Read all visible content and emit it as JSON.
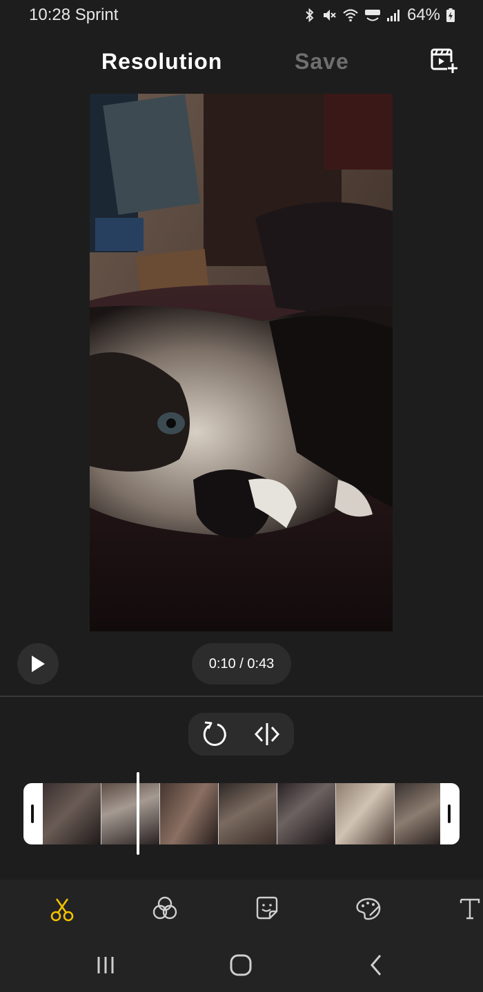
{
  "status_bar": {
    "time_carrier": "10:28 Sprint",
    "battery": "64%"
  },
  "header": {
    "title": "Resolution",
    "save_label": "Save"
  },
  "player": {
    "time": "0:10 / 0:43"
  },
  "colors": {
    "background": "#1d1d1d",
    "accent_active_tool": "#f2c200",
    "save_disabled": "#6f6f6f"
  },
  "bottom_tools": [
    "scissors-icon",
    "filter-icon",
    "sticker-icon",
    "palette-icon",
    "text-icon"
  ],
  "nav": [
    "recents-icon",
    "home-icon",
    "back-icon"
  ]
}
